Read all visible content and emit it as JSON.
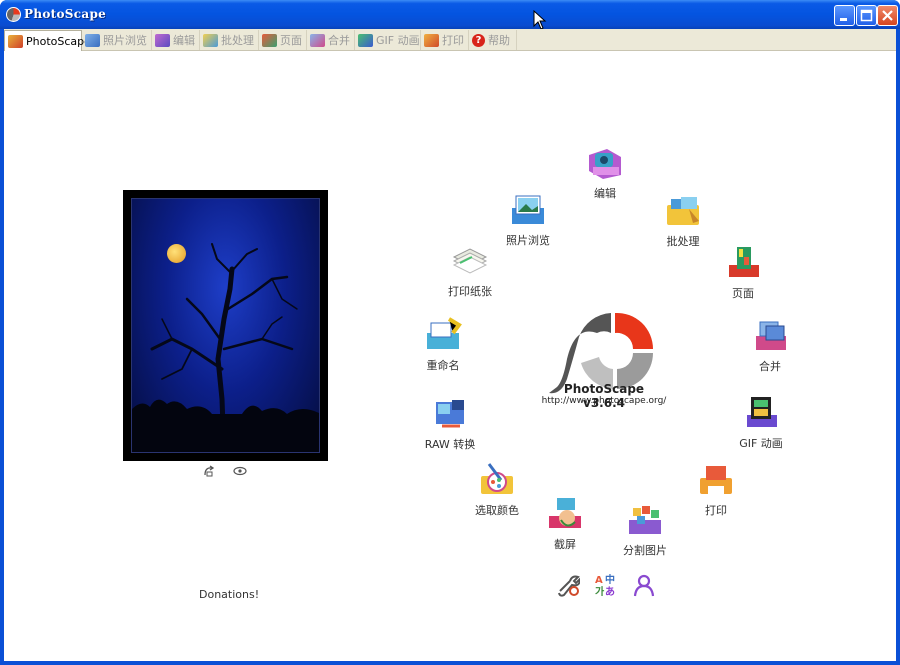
{
  "window": {
    "title": "PhotoScape"
  },
  "tabs": [
    {
      "label": "PhotoScape",
      "icon": "photoscape-tab-icon",
      "active": true
    },
    {
      "label": "照片浏览",
      "icon": "viewer-tab-icon"
    },
    {
      "label": "编辑",
      "icon": "editor-tab-icon"
    },
    {
      "label": "批处理",
      "icon": "batch-tab-icon"
    },
    {
      "label": "页面",
      "icon": "page-tab-icon"
    },
    {
      "label": "合并",
      "icon": "combine-tab-icon"
    },
    {
      "label": "GIF 动画",
      "icon": "gif-tab-icon"
    },
    {
      "label": "打印",
      "icon": "print-tab-icon"
    },
    {
      "label": "帮助",
      "icon": "help-tab-icon"
    }
  ],
  "left": {
    "donations": "Donations!"
  },
  "center": {
    "brand": "PhotoScape v3.6.4",
    "url": "http://www.photoscape.org/"
  },
  "modules": [
    {
      "label": "编辑",
      "icon": "editor-icon"
    },
    {
      "label": "批处理",
      "icon": "batch-icon"
    },
    {
      "label": "页面",
      "icon": "page-icon"
    },
    {
      "label": "合并",
      "icon": "combine-icon"
    },
    {
      "label": "GIF 动画",
      "icon": "gif-animation-icon"
    },
    {
      "label": "打印",
      "icon": "print-icon"
    },
    {
      "label": "分割图片",
      "icon": "splitter-icon"
    },
    {
      "label": "截屏",
      "icon": "screen-capture-icon"
    },
    {
      "label": "选取颜色",
      "icon": "color-picker-icon"
    },
    {
      "label": "RAW 转换",
      "icon": "raw-converter-icon"
    },
    {
      "label": "重命名",
      "icon": "rename-icon"
    },
    {
      "label": "打印纸张",
      "icon": "paper-print-icon"
    },
    {
      "label": "照片浏览",
      "icon": "viewer-icon"
    }
  ],
  "colors": {
    "titlebar": "#0454e0",
    "accent_red": "#e83a1e",
    "tabbar": "#ece9d8"
  }
}
